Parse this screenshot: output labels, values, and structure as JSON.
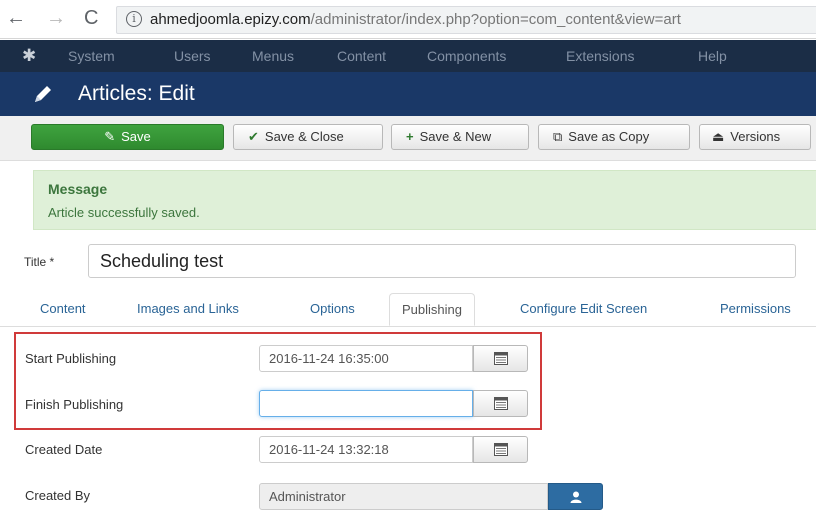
{
  "browser": {
    "url_host": "ahmedjoomla.epizy.com",
    "url_path": "/administrator/index.php?option=com_content&view=art"
  },
  "admin_menu": [
    "System",
    "Users",
    "Menus",
    "Content",
    "Components",
    "Extensions",
    "Help"
  ],
  "page_title": "Articles: Edit",
  "toolbar": {
    "save": "Save",
    "save_close": "Save & Close",
    "save_new": "Save & New",
    "save_copy": "Save as Copy",
    "versions": "Versions"
  },
  "message": {
    "heading": "Message",
    "text": "Article successfully saved."
  },
  "title_field": {
    "label": "Title *",
    "value": "Scheduling test"
  },
  "tabs": [
    "Content",
    "Images and Links",
    "Options",
    "Publishing",
    "Configure Edit Screen",
    "Permissions"
  ],
  "active_tab": "Publishing",
  "publishing": {
    "start_label": "Start Publishing",
    "start_value": "2016-11-24 16:35:00",
    "finish_label": "Finish Publishing",
    "finish_value": "",
    "created_label": "Created Date",
    "created_value": "2016-11-24 13:32:18",
    "created_by_label": "Created By",
    "created_by_value": "Administrator"
  },
  "colors": {
    "admin_menu_bg": "#1b2d46",
    "title_bar_bg": "#1a3867",
    "save_green": "#2f8a2f",
    "message_bg": "#dff0d8",
    "highlight_red": "#d03a3a",
    "user_button_blue": "#2d6ca2"
  }
}
